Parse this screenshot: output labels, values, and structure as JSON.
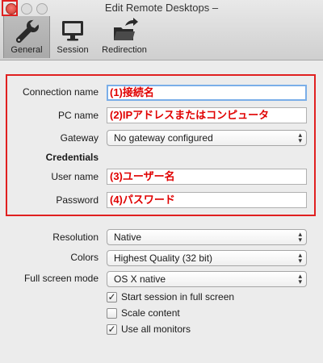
{
  "window": {
    "title": "Edit Remote Desktops –"
  },
  "toolbar": {
    "general": "General",
    "session": "Session",
    "redirection": "Redirection"
  },
  "form": {
    "connection_name": {
      "label": "Connection name",
      "value": "(1)接続名"
    },
    "pc_name": {
      "label": "PC name",
      "value": "(2)IPアドレスまたはコンピュータ"
    },
    "gateway": {
      "label": "Gateway",
      "value": "No gateway configured"
    },
    "credentials_heading": "Credentials",
    "user_name": {
      "label": "User name",
      "value": "(3)ユーザー名"
    },
    "password": {
      "label": "Password",
      "value": "(4)パスワード"
    }
  },
  "display": {
    "resolution": {
      "label": "Resolution",
      "value": "Native"
    },
    "colors": {
      "label": "Colors",
      "value": "Highest Quality (32 bit)"
    },
    "full_screen_mode": {
      "label": "Full screen mode",
      "value": "OS X native"
    }
  },
  "options": [
    {
      "label": "Start session in full screen",
      "checked": true
    },
    {
      "label": "Scale content",
      "checked": false
    },
    {
      "label": "Use all monitors",
      "checked": true
    }
  ],
  "colors": {
    "highlight": "#e02020",
    "annotation_text": "#e00000",
    "focus_ring": "#7aaee8"
  }
}
